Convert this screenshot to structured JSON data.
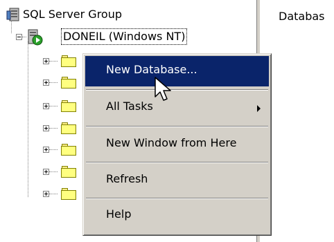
{
  "tree": {
    "root_label": "SQL Server Group",
    "server_label": "DONEIL (Windows NT)",
    "child_folder_count": 6
  },
  "right_pane": {
    "header_text": "Databas"
  },
  "context_menu": {
    "items": [
      {
        "label": "New Database...",
        "selected": true,
        "has_submenu": false
      },
      {
        "label": "All Tasks",
        "selected": false,
        "has_submenu": true
      },
      {
        "label": "New Window from Here",
        "selected": false,
        "has_submenu": false
      },
      {
        "label": "Refresh",
        "selected": false,
        "has_submenu": false
      },
      {
        "label": "Help",
        "selected": false,
        "has_submenu": false
      }
    ]
  },
  "colors": {
    "menu_selection": "#0a246a",
    "menu_background": "#d4d0c8",
    "folder_fill": "#ffff80",
    "server_status_green": "#2aa02a"
  },
  "icons": {
    "root": "server-group-icon",
    "server": "server-running-icon",
    "folder": "folder-icon",
    "cursor": "mouse-pointer-icon"
  }
}
